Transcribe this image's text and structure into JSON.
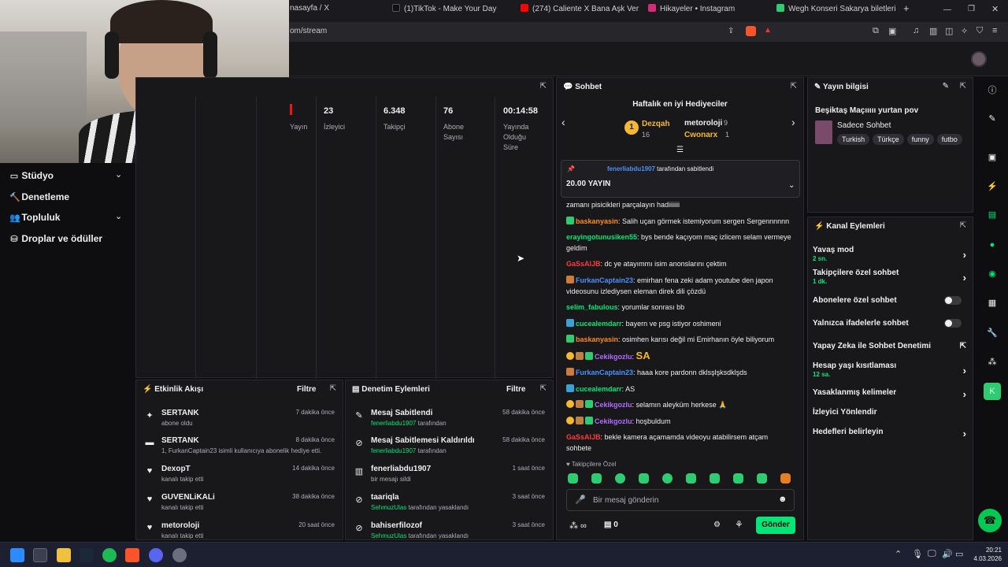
{
  "browser": {
    "tabs": [
      {
        "label": "nasayfa / X",
        "color": "#222"
      },
      {
        "label": "(1)TikTok - Make Your Day",
        "color": "#111"
      },
      {
        "label": "(274) Caliente X Bana Aşk Ver (ALPE",
        "color": "#ff0000"
      },
      {
        "label": "Hikayeler • Instagram",
        "color": "#d62976"
      },
      {
        "label": "Wegh Konseri Sakarya biletleri | Bub",
        "color": "#2ecc71"
      }
    ],
    "new_tab": "+",
    "url": "om/stream"
  },
  "stats": [
    {
      "num": "",
      "label": "Yayın"
    },
    {
      "num": "23",
      "label": "İzleyici"
    },
    {
      "num": "6.348",
      "label": "Takipçi"
    },
    {
      "num": "76",
      "label": "Abone Sayısı"
    },
    {
      "num": "00:14:58",
      "label": "Yayında Olduğu Süre"
    }
  ],
  "sidebar": {
    "items": [
      "Stüdyo",
      "Denetleme",
      "Topluluk",
      "Droplar ve ödüller"
    ]
  },
  "activity": {
    "title": "Etkinlik Akışı",
    "filter": "Filtre",
    "events": [
      {
        "name": "SERTANK",
        "sub": "abone oldu",
        "time": "7 dakika önce",
        "icon": "✦",
        "green": false
      },
      {
        "name": "SERTANK",
        "sub": "1, FurkanCaptain23 isimli kullanıcıya abonelik hediye etti.",
        "time": "8 dakika önce",
        "icon": "▬",
        "green": true
      },
      {
        "name": "DexopT",
        "sub": "kanalı takip etti",
        "time": "14 dakika önce",
        "icon": "♥",
        "green": false
      },
      {
        "name": "GUVENLiKALi",
        "sub": "kanalı takip etti",
        "time": "38 dakika önce",
        "icon": "♥",
        "green": false
      },
      {
        "name": "metoroloji",
        "sub": "kanalı takip etti",
        "time": "20 saat önce",
        "icon": "♥",
        "green": false
      }
    ]
  },
  "moderation": {
    "title": "Denetim Eylemleri",
    "filter": "Filtre",
    "events": [
      {
        "name": "Mesaj Sabitlendi",
        "user": "fenerliabdu1907",
        "rest": "tarafından",
        "time": "58 dakika önce",
        "icon": "📌"
      },
      {
        "name": "Mesaj Sabitlemesi Kaldırıldı",
        "user": "fenerliabdu1907",
        "rest": "tarafından",
        "time": "58 dakika önce",
        "icon": "⊘"
      },
      {
        "name": "fenerliabdu1907",
        "user": "",
        "rest": "bir mesajı sildi",
        "time": "1 saat önce",
        "icon": "🗑"
      },
      {
        "name": "taariqla",
        "user": "SehmuzUlas",
        "rest": "tarafından yasaklandı",
        "time": "3 saat önce",
        "icon": "⊘"
      },
      {
        "name": "bahiserfilozof",
        "user": "SehmuzUlas",
        "rest": "tarafından yasaklandı",
        "time": "3 saat önce",
        "icon": "⊘"
      }
    ]
  },
  "chat": {
    "title": "Sohbet",
    "gifters_title": "Haftalık en iyi Hediyeciler",
    "gifters": [
      {
        "rank": "1",
        "name": "Dezqah",
        "count": "16"
      },
      {
        "rank": "",
        "name": "metoroloji",
        "count": "9"
      },
      {
        "rank": "",
        "name": "Cwonarx",
        "count": "1"
      }
    ],
    "pinned_by": "fenerliabdu1907",
    "pinned_suffix": "tarafından sabitlendi",
    "pinned_text": "20.00 YAYIN",
    "messages": [
      {
        "user": "",
        "color": "#efeff1",
        "text": "zamanı pisicikleri parçalayın hadiiiiiii"
      },
      {
        "user": "baskanyasin",
        "color": "#ff8c00",
        "text": "Salih uçan görmek istemiyorum sergen Sergennnnnn"
      },
      {
        "user": "erayingotunusiken55",
        "color": "#00e676",
        "text": "bys bende kaçıyom maç izlicem selam vermeye geldim"
      },
      {
        "user": "GaSsAlJB",
        "color": "#ff3b3b",
        "text": "dc ye atayımmı isim anonslarını çektim"
      },
      {
        "user": "FurkanCaptain23",
        "color": "#4a90ff",
        "text": "emirhan fena zeki adam youtube den japon videosunu izlediysen eleman direk dili çözdü"
      },
      {
        "user": "selim_fabulous",
        "color": "#00e676",
        "text": "yorumlar sonrası bb"
      },
      {
        "user": "cucealemdarr",
        "color": "#00e676",
        "text": "bayern ve psg istiyor oshimeni"
      },
      {
        "user": "baskanyasin",
        "color": "#ff8c00",
        "text": "osimhen karısı değil mi Emirhanın öyle biliyorum"
      },
      {
        "user": "Cekikgozlu",
        "color": "#b26bff",
        "text": "SA"
      },
      {
        "user": "FurkanCaptain23",
        "color": "#4a90ff",
        "text": "haaa kore pardonn dklsşlşksdklşds"
      },
      {
        "user": "cucealemdarr",
        "color": "#00e676",
        "text": "AS"
      },
      {
        "user": "Cekikgozlu",
        "color": "#b26bff",
        "text": "selamın aleyküm herkese 🙏"
      },
      {
        "user": "Cekikgozlu",
        "color": "#b26bff",
        "text": "hoşbuldum"
      },
      {
        "user": "GaSsAlJB",
        "color": "#ff3b3b",
        "text": "bekle kamera açamamda videoyu atabilirsem atçam sohbete"
      }
    ],
    "followers_only": "Takipçilere Özel",
    "input_placeholder": "Bir mesaj gönderin",
    "send": "Gönder",
    "points": "0"
  },
  "info": {
    "title": "Yayın bilgisi",
    "stream_title": "Beşiktaş Maçııııı yurtan pov",
    "category": "Sadece Sohbet",
    "tags": [
      "Turkish",
      "Türkçe",
      "funny",
      "futbo"
    ]
  },
  "actions": {
    "title": "Kanal Eylemleri",
    "items": [
      {
        "label": "Yavaş mod",
        "sub": "2 sn.",
        "kind": "chev"
      },
      {
        "label": "Takipçilere özel sohbet",
        "sub": "1 dk.",
        "kind": "chev"
      },
      {
        "label": "Abonelere özel sohbet",
        "sub": "",
        "kind": "toggle"
      },
      {
        "label": "Yalnızca ifadelerle sohbet",
        "sub": "",
        "kind": "toggle"
      },
      {
        "label": "Yapay Zeka ile Sohbet Denetimi",
        "sub": "",
        "kind": "ext"
      },
      {
        "label": "Hesap yaşı kısıtlaması",
        "sub": "12 sa.",
        "kind": "chev"
      },
      {
        "label": "Yasaklanmış kelimeler",
        "sub": "",
        "kind": "chev"
      },
      {
        "label": "İzleyici Yönlendir",
        "sub": "",
        "kind": "none"
      },
      {
        "label": "Hedefleri belirleyin",
        "sub": "",
        "kind": "chev"
      }
    ]
  },
  "taskbar": {
    "time": "20:21",
    "date": "4.03.2026"
  },
  "colors": {
    "accent": "#00e676",
    "panel": "#18181b",
    "bg": "#0e0e10"
  }
}
